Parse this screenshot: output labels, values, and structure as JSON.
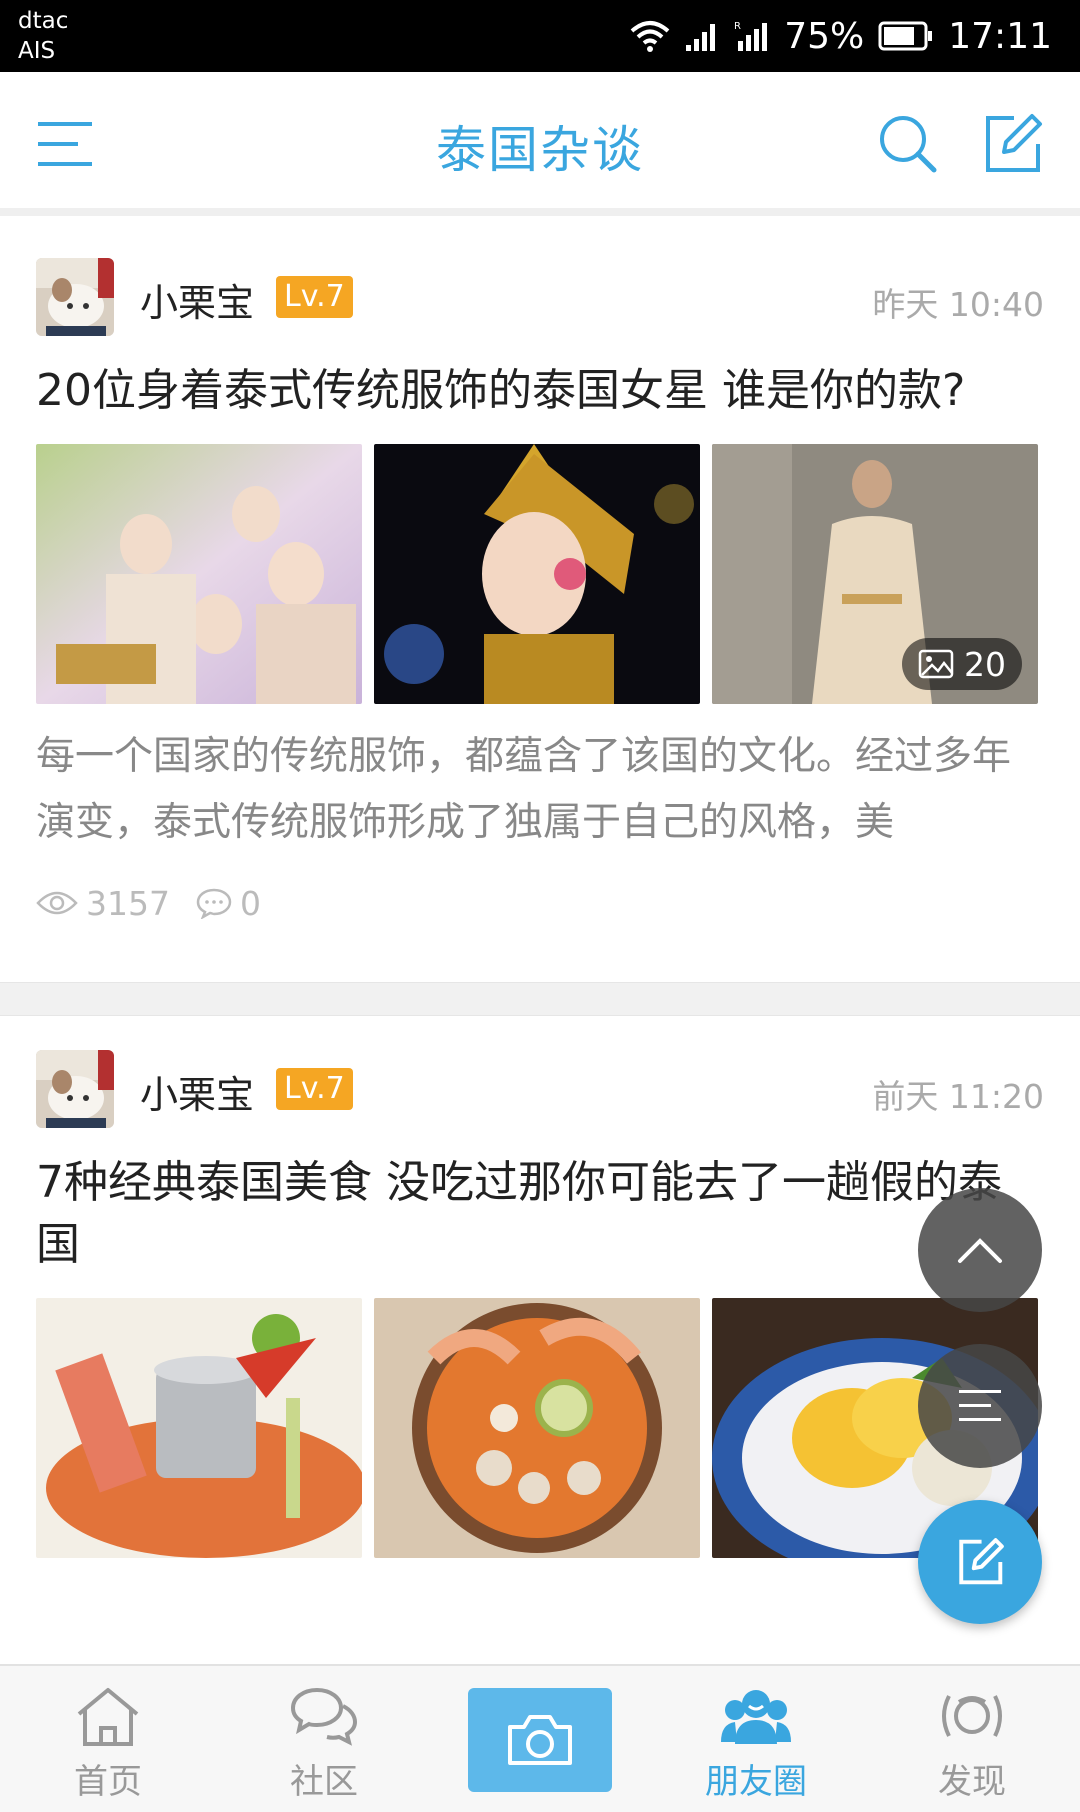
{
  "status_bar": {
    "carrier_1": "dtac",
    "carrier_2": "AIS",
    "battery": "75%",
    "time": "17:11"
  },
  "header": {
    "title": "泰国杂谈"
  },
  "posts": [
    {
      "author": "小栗宝",
      "level": "Lv.7",
      "time": "昨天 10:40",
      "title": "20位身着泰式传统服饰的泰国女星 谁是你的款?",
      "image_count": "20",
      "excerpt": "每一个国家的传统服饰，都蕴含了该国的文化。经过多年演变，泰式传统服饰形成了独属于自己的风格，美",
      "views": "3157",
      "comments": "0"
    },
    {
      "author": "小栗宝",
      "level": "Lv.7",
      "time": "前天 11:20",
      "title": "7种经典泰国美食 没吃过那你可能去了一趟假的泰国"
    }
  ],
  "bottom_nav": {
    "items": [
      {
        "label": "首页",
        "icon": "home-icon"
      },
      {
        "label": "社区",
        "icon": "chat-icon"
      },
      {
        "label": "",
        "icon": "camera-icon"
      },
      {
        "label": "朋友圈",
        "icon": "friends-icon"
      },
      {
        "label": "发现",
        "icon": "discover-icon"
      }
    ],
    "active_index": 3
  },
  "colors": {
    "accent": "#3aa6df",
    "level_badge": "#f5a623",
    "muted_text": "#888888"
  }
}
